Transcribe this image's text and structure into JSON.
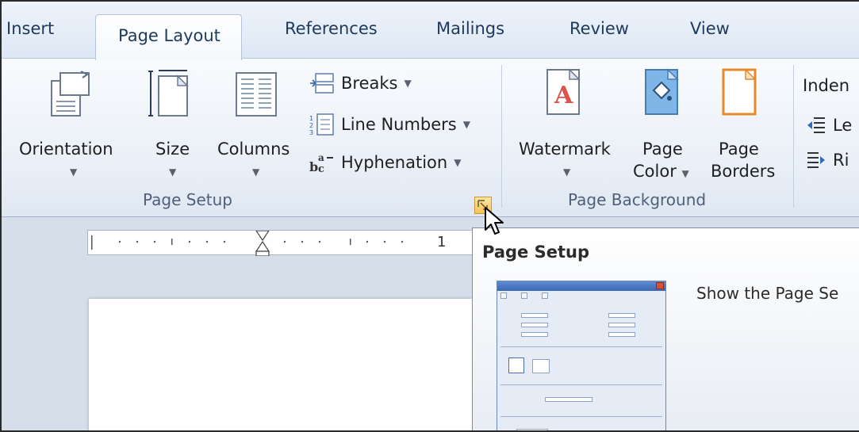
{
  "tabs": [
    {
      "label": "Insert"
    },
    {
      "label": "Page Layout",
      "active": true
    },
    {
      "label": "References"
    },
    {
      "label": "Mailings"
    },
    {
      "label": "Review"
    },
    {
      "label": "View"
    }
  ],
  "page_setup": {
    "orientation": "Orientation",
    "size": "Size",
    "columns": "Columns",
    "breaks": "Breaks",
    "line_numbers": "Line Numbers",
    "hyphenation": "Hyphenation",
    "group_label": "Page Setup"
  },
  "page_background": {
    "watermark": "Watermark",
    "page_color_1": "Page",
    "page_color_2": "Color",
    "page_borders_1": "Page",
    "page_borders_2": "Borders",
    "group_label": "Page Background"
  },
  "paragraph": {
    "indent": "Inden",
    "left": "Le",
    "right": "Ri"
  },
  "ruler": {
    "mark": "1"
  },
  "tooltip": {
    "title": "Page Setup",
    "description": "Show the Page Se"
  },
  "colors": {
    "accent": "#1e395b",
    "launcher": "#f6c35a"
  }
}
